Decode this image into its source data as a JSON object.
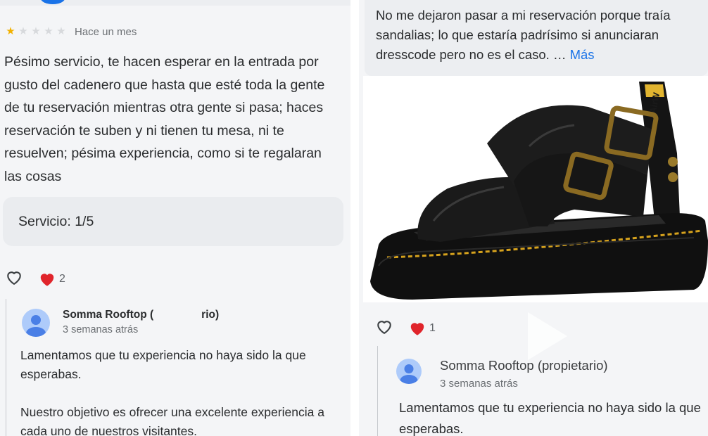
{
  "left": {
    "review": {
      "rating": 1,
      "rating_max": 5,
      "date": "Hace un mes",
      "text": "Pésimo servicio, te hacen esperar en la entrada por gusto del cadenero que hasta que esté toda la gente de tu reservación mientras otra gente si pasa; haces reservación te suben y ni tienen tu mesa, ni te resuelven; pésima experiencia, como si te regalaran las cosas",
      "service_rating": "Servicio: 1/5"
    },
    "reactions": {
      "like_count": "2"
    },
    "owner_reply": {
      "name_start": "Somma Rooftop (",
      "name_end": "rio)",
      "date": "3 semanas atrás",
      "paragraph_1": "Lamentamos que tu experiencia no haya sido la que esperabas.",
      "paragraph_2": "Nuestro objetivo es ofrecer una excelente experiencia a cada uno de nuestros visitantes."
    }
  },
  "right": {
    "review": {
      "text": "No me dejaron pasar a mi reservación porque traía sandalias; lo que estaría padrísimo si anunciaran dresscode pero no es el caso. …",
      "more_link": "Más"
    },
    "photo": {
      "strap_print": "AirW"
    },
    "reactions": {
      "like_count": "1"
    },
    "owner_reply": {
      "name": "Somma Rooftop (propietario)",
      "date": "3 semanas atrás",
      "text": "Lamentamos que tu experiencia no haya sido la que esperabas."
    }
  },
  "colors": {
    "star_on": "#f2b100",
    "star_off": "#d7d9dc",
    "heart": "#e0242b",
    "link": "#1a73e8",
    "avatar_bg": "#aecbfa",
    "avatar_fg": "#4a7fe6",
    "shoe_stitch": "#d6a21d"
  },
  "icons": [
    "star-icon",
    "heart-outline-icon",
    "heart-filled-icon",
    "avatar-icon",
    "play-icon"
  ]
}
